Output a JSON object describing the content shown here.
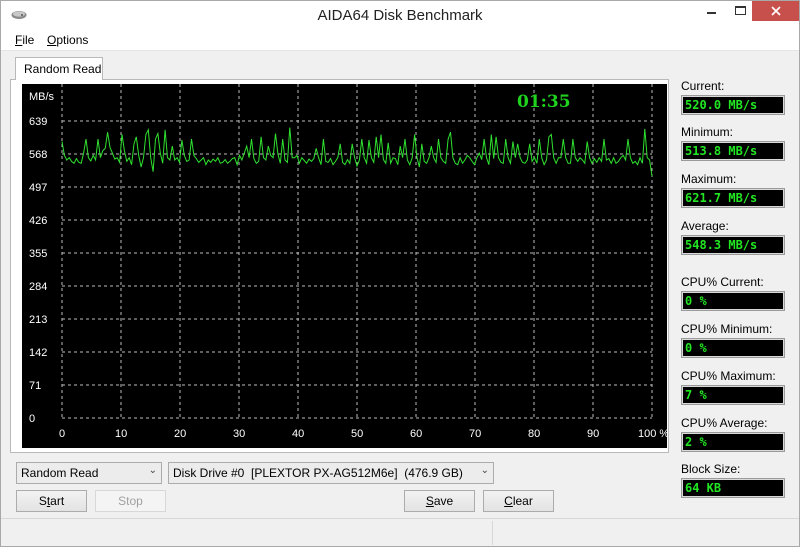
{
  "window": {
    "title": "AIDA64 Disk Benchmark",
    "app_icon": "disk-drive-icon",
    "controls": {
      "minimize": "minimize-icon",
      "maximize": "maximize-icon",
      "close": "close-icon"
    }
  },
  "menu": [
    {
      "label": "File",
      "accel": "F",
      "rest": "ile"
    },
    {
      "label": "Options",
      "accel": "O",
      "rest": "ptions"
    }
  ],
  "tabs": [
    {
      "label": "Random Read",
      "active": true
    }
  ],
  "timer": "01:35",
  "stats": {
    "current": {
      "label": "Current:",
      "value": "520.0 MB/s"
    },
    "minimum": {
      "label": "Minimum:",
      "value": "513.8 MB/s"
    },
    "maximum": {
      "label": "Maximum:",
      "value": "621.7 MB/s"
    },
    "average": {
      "label": "Average:",
      "value": "548.3 MB/s"
    },
    "cpu_current": {
      "label": "CPU% Current:",
      "value": "0 %"
    },
    "cpu_minimum": {
      "label": "CPU% Minimum:",
      "value": "0 %"
    },
    "cpu_maximum": {
      "label": "CPU% Maximum:",
      "value": "7 %"
    },
    "cpu_average": {
      "label": "CPU% Average:",
      "value": "2 %"
    },
    "block_size": {
      "label": "Block Size:",
      "value": "64 KB"
    }
  },
  "controls": {
    "test_select": "Random Read",
    "drive_select": "Disk Drive #0  [PLEXTOR PX-AG512M6e]  (476.9 GB)",
    "start": {
      "accel_pre": "S",
      "accel": "t",
      "rest": "art"
    },
    "stop": "Stop",
    "save": {
      "accel": "S",
      "rest": "ave"
    },
    "clear": {
      "accel": "C",
      "rest": "lear"
    }
  },
  "colors": {
    "trace": "#2fe02f",
    "timer": "#1ed21e",
    "readout": "#22e622",
    "grid": "#bdbdbd",
    "close_button": "#c7504c"
  },
  "chart_data": {
    "type": "line",
    "title": "",
    "ylabel": "MB/s",
    "xlabel": "%",
    "ylim": [
      0,
      639
    ],
    "xlim": [
      0,
      100
    ],
    "yticks": [
      0,
      71,
      142,
      213,
      284,
      355,
      426,
      497,
      568,
      639
    ],
    "xticks": [
      0,
      10,
      20,
      30,
      40,
      50,
      60,
      70,
      80,
      90,
      100
    ],
    "xtick_labels": [
      "0",
      "10",
      "20",
      "30",
      "40",
      "50",
      "60",
      "70",
      "80",
      "90",
      "100 %"
    ],
    "grid": true,
    "series": [
      {
        "name": "Random Read",
        "x_range": [
          0,
          100
        ],
        "values": [
          595,
          565,
          555,
          560,
          552,
          548,
          558,
          550,
          548,
          570,
          600,
          560,
          553,
          565,
          555,
          600,
          560,
          575,
          580,
          615,
          582,
          570,
          557,
          560,
          550,
          610,
          575,
          552,
          560,
          545,
          590,
          605,
          565,
          540,
          560,
          610,
          620,
          560,
          530,
          600,
          612,
          570,
          548,
          620,
          560,
          555,
          585,
          555,
          560,
          550,
          598,
          565,
          552,
          555,
          600,
          565,
          558,
          550,
          555,
          560,
          545,
          555,
          550,
          557,
          552,
          560,
          548,
          550,
          556,
          548,
          552,
          558,
          560,
          545,
          565,
          555,
          570,
          585,
          560,
          600,
          558,
          548,
          552,
          605,
          560,
          555,
          585,
          565,
          560,
          612,
          568,
          548,
          600,
          555,
          550,
          625,
          560,
          560,
          565,
          548,
          560,
          554,
          548,
          557,
          552,
          558,
          580,
          560,
          545,
          600,
          552,
          550,
          558,
          545,
          552,
          560,
          590,
          550,
          545,
          556,
          548,
          590,
          560,
          542,
          555,
          600,
          560,
          548,
          598,
          560,
          550,
          605,
          560,
          610,
          556,
          548,
          592,
          548,
          560,
          558,
          545,
          585,
          560,
          600,
          555,
          545,
          560,
          610,
          560,
          540,
          590,
          552,
          548,
          560,
          585,
          560,
          550,
          600,
          560,
          552,
          548,
          600,
          615,
          560,
          548,
          545,
          560,
          548,
          555,
          565,
          560,
          552,
          545,
          560,
          570,
          556,
          600,
          560,
          545,
          610,
          558,
          605,
          560,
          550,
          548,
          600,
          560,
          548,
          595,
          560,
          590,
          560,
          550,
          548,
          555,
          590,
          552,
          560,
          548,
          600,
          560,
          545,
          555,
          605,
          610,
          560,
          548,
          560,
          560,
          600,
          560,
          548,
          548,
          600,
          560,
          552,
          560,
          555,
          548,
          595,
          560,
          548,
          558,
          550,
          560,
          552,
          600,
          555,
          558,
          548,
          560,
          548,
          552,
          560,
          565,
          555,
          600,
          560,
          548,
          552,
          545,
          560,
          548,
          622,
          560,
          555,
          520
        ]
      }
    ],
    "annotation": "01:35"
  }
}
